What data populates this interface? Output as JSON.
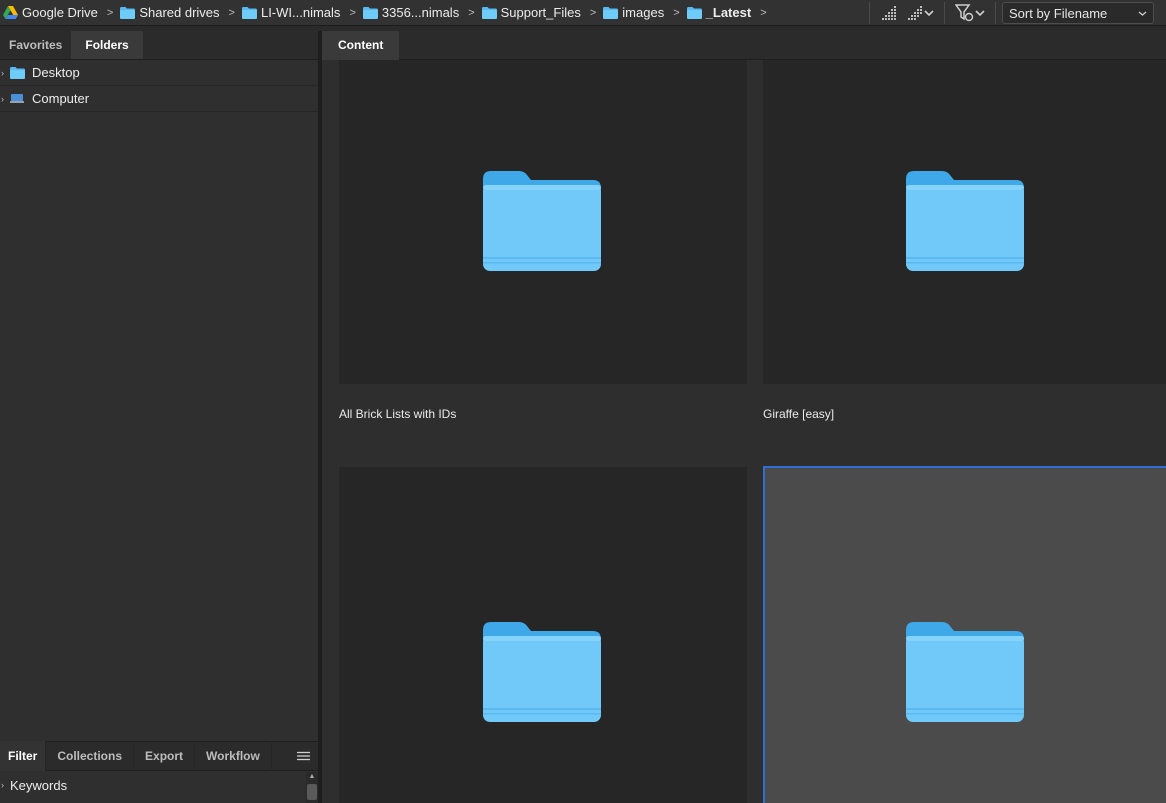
{
  "breadcrumb": [
    {
      "label": "Google Drive",
      "icon": "google-drive-icon",
      "bold": false
    },
    {
      "label": "Shared drives",
      "icon": "folder-icon",
      "bold": false
    },
    {
      "label": "LI-WI...nimals",
      "icon": "folder-icon",
      "bold": false
    },
    {
      "label": "3356...nimals",
      "icon": "folder-icon",
      "bold": false
    },
    {
      "label": "Support_Files",
      "icon": "folder-icon",
      "bold": false
    },
    {
      "label": "images",
      "icon": "folder-icon",
      "bold": false
    },
    {
      "label": "_Latest",
      "icon": "folder-icon",
      "bold": true
    }
  ],
  "toolbar": {
    "quality_icon": "signal-quality-icon",
    "quality_menu_icon": "signal-quality-menu-icon",
    "filter_icon": "filter-menu-icon",
    "sort_label": "Sort by Filename"
  },
  "left_panel": {
    "tabs": [
      "Favorites",
      "Folders"
    ],
    "active_tab": "Folders",
    "tree": [
      {
        "label": "Desktop",
        "icon": "folder-icon"
      },
      {
        "label": "Computer",
        "icon": "computer-icon"
      }
    ]
  },
  "bottom_panel": {
    "tabs": [
      "Filter",
      "Collections",
      "Export",
      "Workflow"
    ],
    "active_tab": "Filter",
    "menu_icon": "hamburger-menu-icon",
    "sections": [
      {
        "label": "Keywords"
      }
    ]
  },
  "content": {
    "tab": "Content",
    "items": [
      {
        "label": "All Brick Lists with IDs",
        "selected": false
      },
      {
        "label": "Giraffe [easy]",
        "selected": false
      },
      {
        "label": "",
        "selected": false
      },
      {
        "label": "",
        "selected": true
      }
    ]
  },
  "colors": {
    "folder": "#66c4f5",
    "selection": "#2f6fd6",
    "background": "#2a2a2a"
  }
}
